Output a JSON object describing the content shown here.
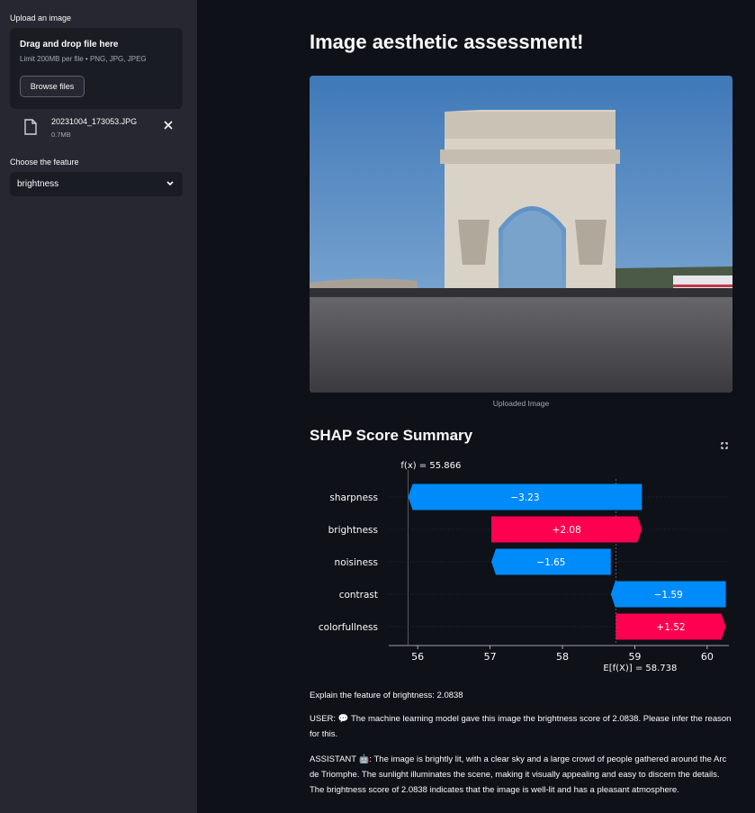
{
  "sidebar": {
    "upload_label": "Upload an image",
    "dropzone_title": "Drag and drop file here",
    "dropzone_limit": "Limit 200MB per file • PNG, JPG, JPEG",
    "browse_label": "Browse files",
    "file_name": "20231004_173053.JPG",
    "file_size": "0.7MB",
    "feature_label": "Choose the feature",
    "feature_value": "brightness"
  },
  "main": {
    "title": "Image aesthetic assessment!",
    "image_caption": "Uploaded Image",
    "shap_title": "SHAP Score Summary",
    "explain_line": "Explain the feature of brightness: 2.0838",
    "user_msg": "USER: 💬 The machine learning model gave this image the brightness score of 2.0838. Please infer the reason for this.",
    "assistant_msg": "ASSISTANT 🤖: The image is brightly lit, with a clear sky and a large crowd of people gathered around the Arc de Triomphe. The sunlight illuminates the scene, making it visually appealing and easy to discern the details. The brightness score of 2.0838 indicates that the image is well-lit and has a pleasant atmosphere."
  },
  "chart_data": {
    "type": "waterfall",
    "features": [
      "sharpness",
      "brightness",
      "noisiness",
      "contrast",
      "colorfullness"
    ],
    "contributions": [
      -3.23,
      2.08,
      -1.65,
      -1.59,
      1.52
    ],
    "labels": [
      "−3.23",
      "+2.08",
      "−1.65",
      "−1.59",
      "+1.52"
    ],
    "fx_label": "f(x) = 55.866",
    "efx_label": "E[f(X)] = 58.738",
    "fx": 55.866,
    "base": 58.738,
    "xlim": [
      55.6,
      60.3
    ],
    "xticks": [
      56,
      57,
      58,
      59,
      60
    ],
    "colors": {
      "positive": "#ff0051",
      "negative": "#008bfb"
    }
  }
}
